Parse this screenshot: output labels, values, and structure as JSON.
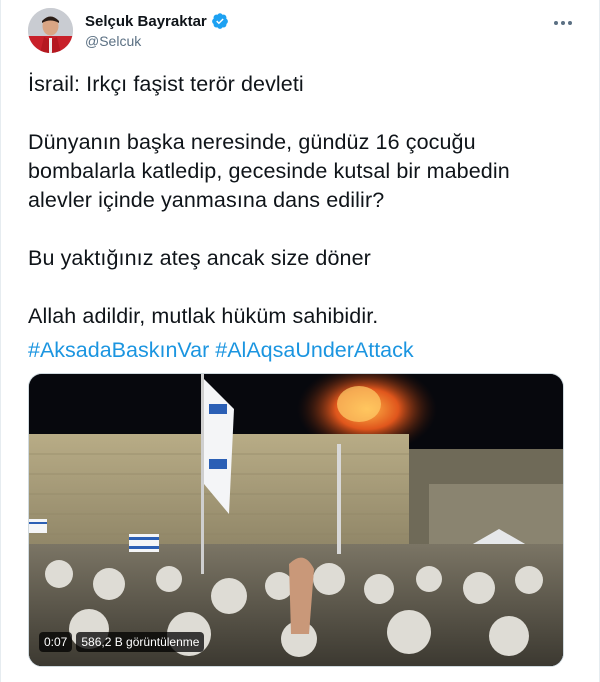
{
  "author": {
    "display_name": "Selçuk Bayraktar",
    "handle": "@Selcuk",
    "verified_color": "#1da1f2"
  },
  "tweet": {
    "paragraphs": [
      "İsrail: Irkçı faşist terör devleti",
      "Dünyanın başka neresinde, gündüz 16 çocuğu bombalarla katledip, gecesinde kutsal bir mabedin alevler içinde yanmasına dans edilir?",
      "Bu yaktığınız ateş ancak size döner",
      "Allah adildir, mutlak hüküm sahibidir."
    ],
    "hashtags": [
      "#AksadaBaskınVar",
      "#AlAqsaUnderAttack"
    ]
  },
  "media": {
    "video_time": "0:07",
    "views": "586,2 B görüntülenme"
  },
  "colors": {
    "link": "#1b95e0",
    "secondary_text": "#5b7083"
  }
}
